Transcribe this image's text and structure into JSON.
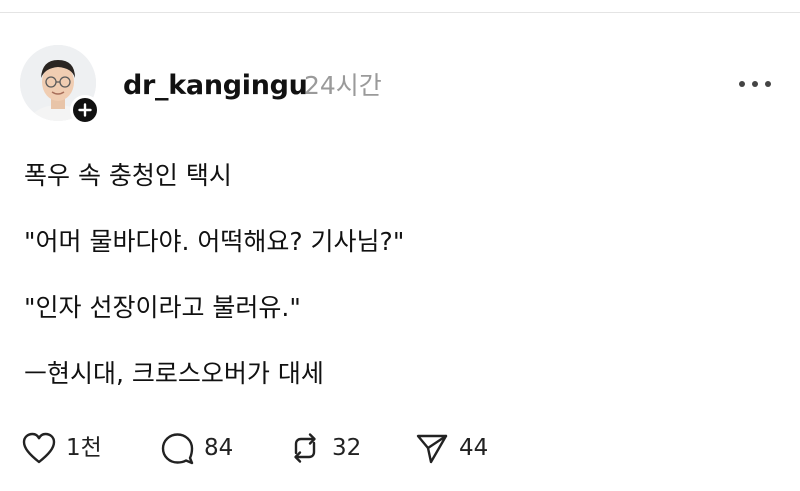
{
  "post": {
    "author": {
      "username": "dr_kangingu",
      "timestamp": "24시간"
    },
    "content": {
      "lines": [
        "폭우 속 충청인 택시",
        "\"어머 물바다야. 어떡해요? 기사님?\"",
        "\"인자 선장이라고 불러유.\"",
        "ㅡ현시대, 크로스오버가 대세"
      ]
    },
    "actions": {
      "like": {
        "icon": "heart-icon",
        "count": "1천"
      },
      "comment": {
        "icon": "comment-icon",
        "count": "84"
      },
      "repost": {
        "icon": "repost-icon",
        "count": "32"
      },
      "share": {
        "icon": "send-icon",
        "count": "44"
      }
    },
    "more_icon": "more-horizontal-icon",
    "follow_icon": "plus-icon"
  }
}
